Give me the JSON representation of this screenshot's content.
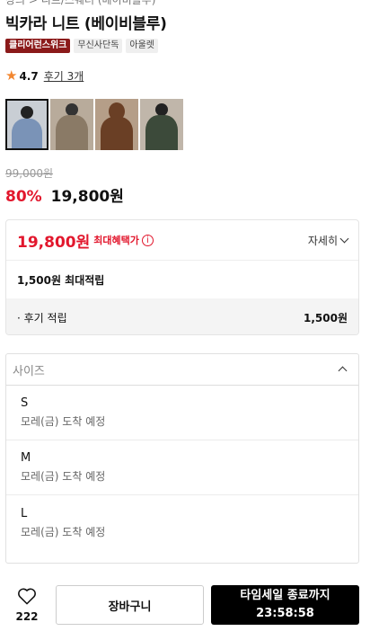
{
  "breadcrumb": "상의 > 니트/스웨터 (베이비블루)",
  "title": "빅카라 니트 (베이비블루)",
  "badges": [
    "클리어런스위크",
    "무신사단독",
    "아울렛"
  ],
  "rating": {
    "score": "4.7",
    "reviews": "후기 3개"
  },
  "thumbnails": [
    {
      "bg": "#c9ced4",
      "figure": "#7a93b7",
      "label": "thumb-1"
    },
    {
      "bg": "#b8ab9b",
      "figure": "#8a7a66",
      "label": "thumb-2"
    },
    {
      "bg": "#b59e88",
      "figure": "#6a3f25",
      "label": "thumb-3"
    },
    {
      "bg": "#c0b6aa",
      "figure": "#3c4a3a",
      "label": "thumb-4"
    }
  ],
  "price": {
    "original": "99,000원",
    "discount": "80%",
    "sale": "19,800원"
  },
  "benefit": {
    "max_price": "19,800원",
    "max_label": "최대혜택가",
    "detail": "자세히",
    "points": "1,500원 최대적립",
    "review_label": "· 후기 적립",
    "review_value": "1,500원"
  },
  "size": {
    "placeholder": "사이즈",
    "options": [
      {
        "name": "S",
        "status": "모레(금) 도착 예정"
      },
      {
        "name": "M",
        "status": "모레(금) 도착 예정"
      },
      {
        "name": "L",
        "status": "모레(금) 도착 예정"
      }
    ]
  },
  "bottom": {
    "likes": "222",
    "cart": "장바구니",
    "buy_line1": "타임세일 종료까지",
    "buy_line2": "23:58:58"
  },
  "colors": {
    "accent": "#e2172d",
    "badge": "#8b1a1a",
    "star": "#f2862f"
  }
}
